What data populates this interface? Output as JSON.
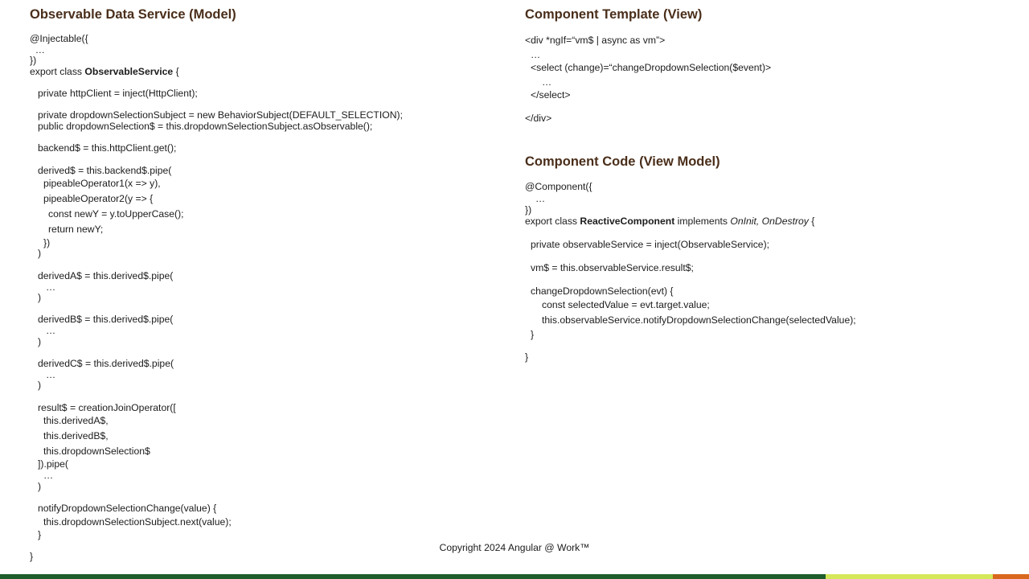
{
  "left_panel": {
    "title": "Observable Data Service (Model)",
    "lines": [
      "@Injectable({",
      "  …",
      "})",
      "export class ",
      "ObservableService",
      " {",
      "private httpClient = inject(HttpClient);",
      "private dropdownSelectionSubject = new BehaviorSubject(DEFAULT_SELECTION);",
      "public dropdownSelection$ = this.dropdownSelectionSubject.asObservable();",
      "backend$ = this.httpClient.get();",
      "derived$ = this.backend$.pipe(",
      "pipeableOperator1(x => y),",
      "pipeableOperator2(y => {",
      "const newY = y.toUpperCase();",
      "return newY;",
      "})",
      ")",
      "derivedA$ = this.derived$.pipe(",
      "…",
      ")",
      "derivedB$ = this.derived$.pipe(",
      "…",
      ")",
      "derivedC$ = this.derived$.pipe(",
      "…",
      ")",
      "result$ = creationJoinOperator([",
      "this.derivedA$,",
      "this.derivedB$,",
      "this.dropdownSelection$",
      "]).pipe(",
      "…",
      ")",
      "notifyDropdownSelectionChange(value) {",
      "this.dropdownSelectionSubject.next(value);",
      "}",
      "}"
    ]
  },
  "template_panel": {
    "title": "Component Template (View)",
    "lines": [
      "<div *ngIf=“vm$ | async as vm”>",
      "…",
      "<select (change)=“changeDropdownSelection($event)>",
      "…",
      "</select>",
      "</div>"
    ]
  },
  "code_panel": {
    "title": "Component Code (View Model)",
    "lines": [
      "@Component({",
      "…",
      "})",
      "export class ",
      "ReactiveComponent",
      " implements ",
      "OnInit, OnDestroy",
      " {",
      "private observableService = inject(ObservableService);",
      "vm$ = this.observableService.result$;",
      "changeDropdownSelection(evt) {",
      "const selectedValue = evt.target.value;",
      "this.observableService.notifyDropdownSelectionChange(selectedValue);",
      "}",
      "}"
    ]
  },
  "footer": {
    "copyright": "Copyright 2024 Angular @ Work™"
  },
  "colors": {
    "title": "#4a2e1a",
    "bar_green": "#1e5e2c",
    "bar_lime": "#d5e85a",
    "bar_orange": "#d9681f"
  }
}
